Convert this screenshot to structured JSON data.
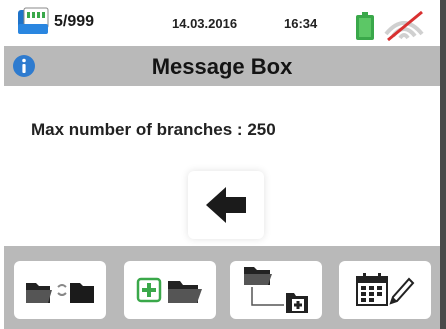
{
  "status": {
    "memory_counter": "5/999",
    "date": "14.03.2016",
    "time": "16:34",
    "icons": {
      "memory": "memory-card-icon",
      "battery": "battery-icon",
      "connection": "no-wifi-icon"
    },
    "colors": {
      "battery": "#3aa84a",
      "no_signal_slash": "#d93030"
    }
  },
  "title": {
    "text": "Message Box",
    "icon": "info-icon",
    "colors": {
      "info": "#2e7bcf",
      "bar": "#b9b9b9"
    }
  },
  "message": {
    "text": "Max number of branches : 250"
  },
  "back_button": {
    "icon": "back-arrow-icon"
  },
  "toolbar": {
    "buttons": [
      {
        "icon": "move-folder-icon"
      },
      {
        "icon": "add-folder-icon"
      },
      {
        "icon": "add-subfolder-icon"
      },
      {
        "icon": "edit-date-icon"
      }
    ],
    "colors": {
      "plus_green": "#3aa84a"
    }
  }
}
